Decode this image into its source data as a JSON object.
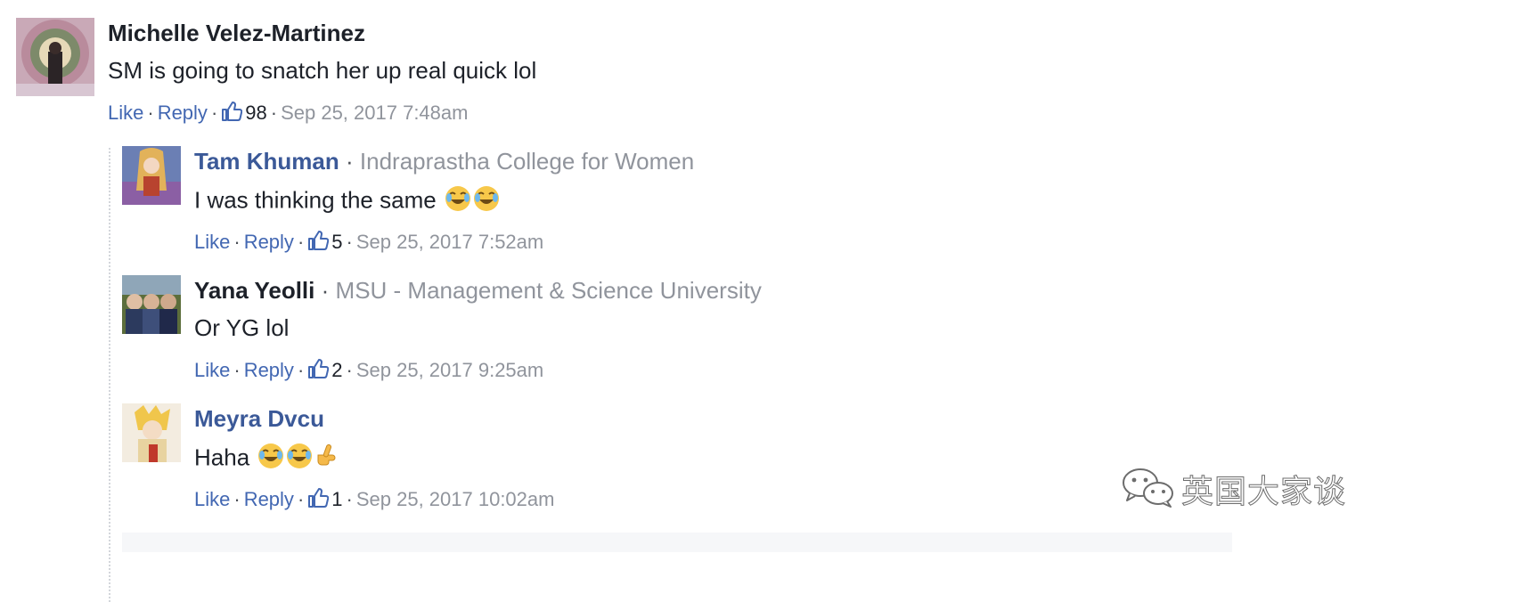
{
  "comments": [
    {
      "author": "Michelle Velez-Martinez",
      "text": "SM is going to snatch her up real quick lol",
      "like_label": "Like",
      "reply_label": "Reply",
      "likes": "98",
      "time": "Sep 25, 2017 7:48am"
    }
  ],
  "replies": [
    {
      "author": "Tam Khuman",
      "affiliation": "Indraprastha College for Women",
      "text": "I was thinking the same",
      "emojis": [
        "joy-emoji",
        "joy-emoji"
      ],
      "like_label": "Like",
      "reply_label": "Reply",
      "likes": "5",
      "time": "Sep 25, 2017 7:52am"
    },
    {
      "author": "Yana Yeolli",
      "affiliation": "MSU - Management & Science University",
      "text": "Or YG lol",
      "like_label": "Like",
      "reply_label": "Reply",
      "likes": "2",
      "time": "Sep 25, 2017 9:25am"
    },
    {
      "author": "Meyra Dvcu",
      "text": "Haha",
      "emojis": [
        "joy-emoji",
        "joy-emoji",
        "pointing-hand-emoji"
      ],
      "like_label": "Like",
      "reply_label": "Reply",
      "likes": "1",
      "time": "Sep 25, 2017 10:02am"
    }
  ],
  "separator": "·",
  "watermark": "英国大家谈",
  "colors": {
    "link": "#4267b2",
    "author_link": "#3b5998",
    "text": "#1d2129",
    "meta": "#90949c"
  }
}
